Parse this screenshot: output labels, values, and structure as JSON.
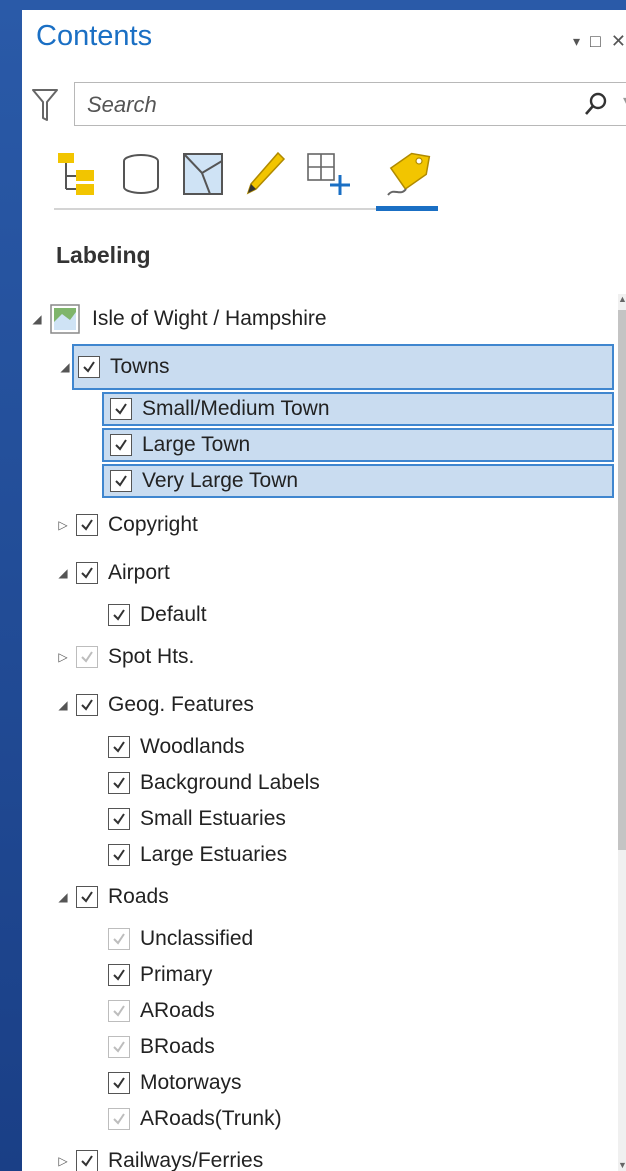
{
  "pane": {
    "title": "Contents",
    "controls": [
      "▾",
      "□",
      "✕"
    ]
  },
  "search": {
    "placeholder": "Search"
  },
  "toolbar": {
    "tools": [
      {
        "name": "list-by-drawing-order-icon"
      },
      {
        "name": "list-by-data-source-icon"
      },
      {
        "name": "list-by-selection-icon"
      },
      {
        "name": "list-by-editing-icon"
      },
      {
        "name": "list-by-snapping-icon"
      },
      {
        "name": "list-by-labeling-icon",
        "active": true
      }
    ]
  },
  "section": {
    "heading": "Labeling"
  },
  "tree": {
    "root": "Isle of Wight / Hampshire",
    "items": {
      "towns": "Towns",
      "small_medium_town": "Small/Medium Town",
      "large_town": "Large Town",
      "very_large_town": "Very Large Town",
      "copyright": "Copyright",
      "airport": "Airport",
      "airport_default": "Default",
      "spot_hts": "Spot Hts.",
      "geog_features": "Geog. Features",
      "woodlands": "Woodlands",
      "background_labels": "Background Labels",
      "small_estuaries": "Small Estuaries",
      "large_estuaries": "Large Estuaries",
      "roads": "Roads",
      "unclassified": "Unclassified",
      "primary": "Primary",
      "aroads": "ARoads",
      "broads": "BRoads",
      "motorways": "Motorways",
      "aroads_trunk": "ARoads(Trunk)",
      "railways_ferries": "Railways/Ferries"
    }
  },
  "colors": {
    "accent": "#1a6fc4",
    "selection_fill": "#c9dcf0",
    "selection_border": "#3f86cf"
  }
}
